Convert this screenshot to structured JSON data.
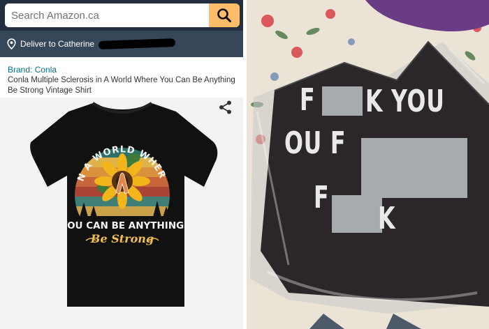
{
  "search": {
    "placeholder": "Search Amazon.ca",
    "icon": "search-icon"
  },
  "delivery": {
    "label": "Deliver to Catherine",
    "icon": "location-pin-icon"
  },
  "product": {
    "brand": "Brand: Conla",
    "title": "Conla Multiple Sclerosis in A World Where You Can Be Anything Be Strong Vintage Shirt",
    "print_top": "IN A WORLD WHERE",
    "print_middle": "YOU CAN BE ANYTHING",
    "print_bottom": "Be Strong",
    "share_icon": "share-icon"
  },
  "received_shirt": {
    "line1_a": "F",
    "line1_b": "K YOU",
    "line2_a": "OU F",
    "line3_a": "F",
    "line3_b": "K"
  },
  "colors": {
    "header": "#232f3e",
    "delivery_bar": "#37475a",
    "search_button": "#febd69",
    "brand_link": "#007185",
    "censor": "#a7abae"
  }
}
